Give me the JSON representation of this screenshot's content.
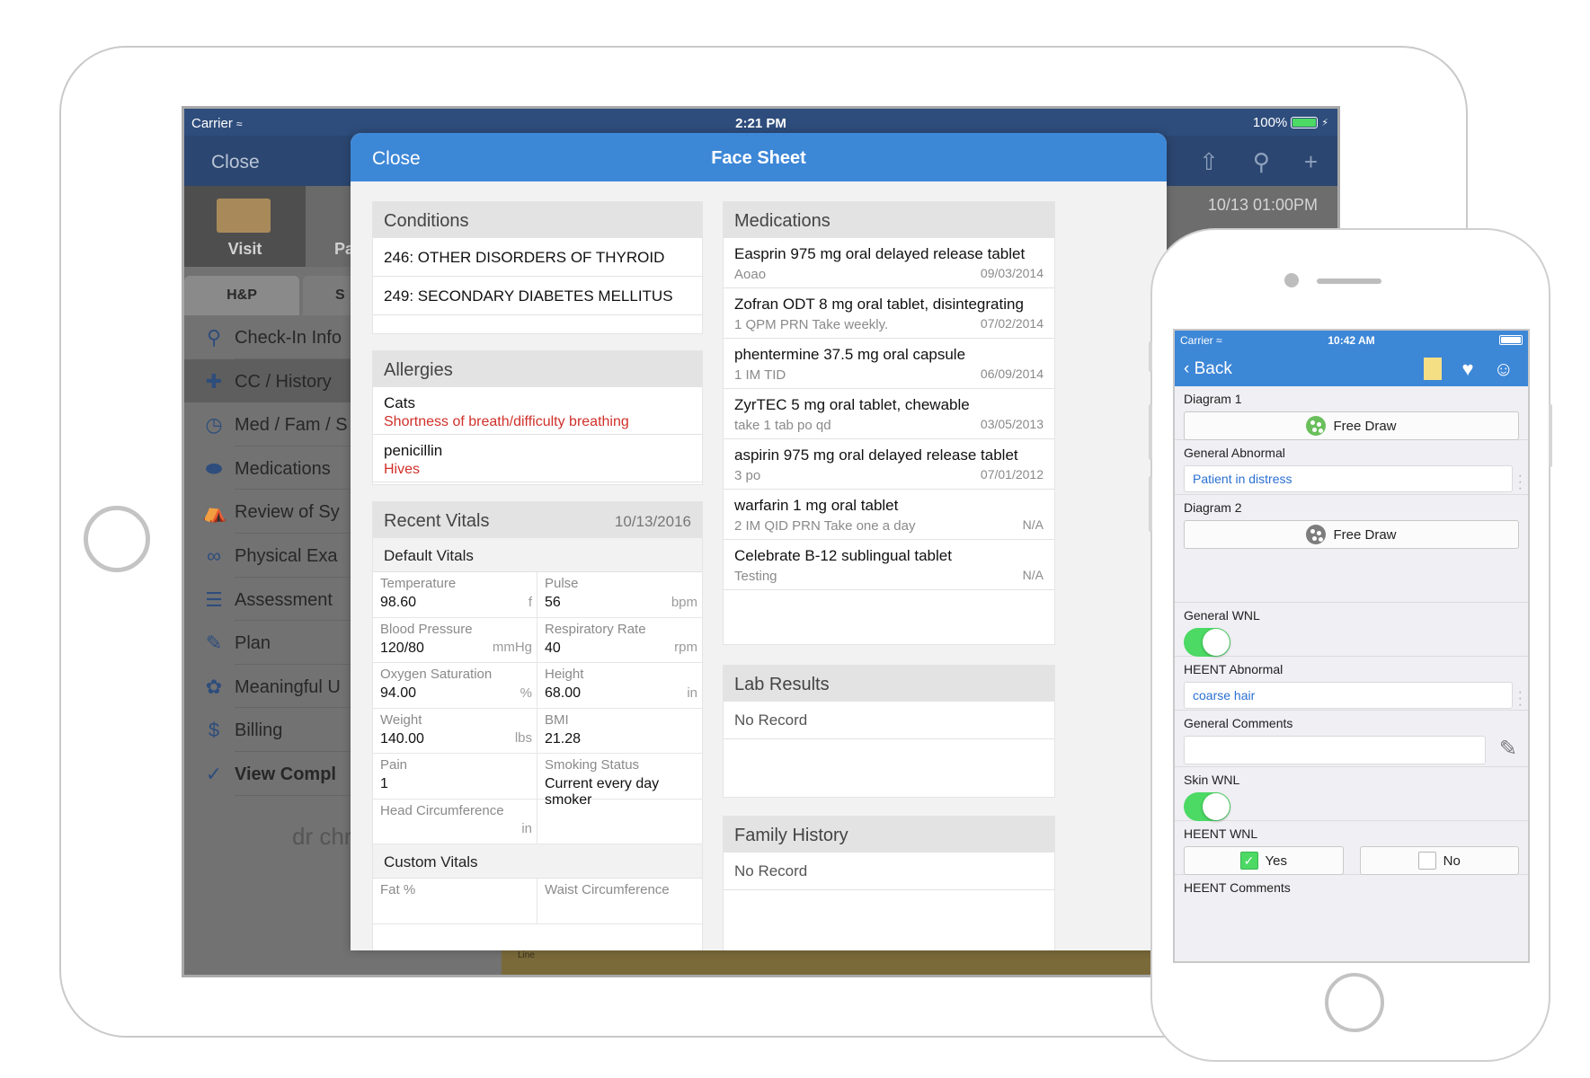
{
  "ipad": {
    "status": {
      "carrier": "Carrier",
      "time": "2:21 PM",
      "battery": "100%"
    },
    "background": {
      "close": "Close",
      "date": "10/13 01:00PM",
      "visit": "Visit",
      "pa_tab": "Pa",
      "tabs": [
        "H&P",
        "S"
      ],
      "menu": [
        {
          "label": "Check-In Info",
          "icon": "map-pin-icon"
        },
        {
          "label": "CC / History",
          "icon": "plus-cross-icon"
        },
        {
          "label": "Med / Fam / S",
          "icon": "history-clock-icon"
        },
        {
          "label": "Medications",
          "icon": "pill-icon"
        },
        {
          "label": "Review of Sy",
          "icon": "body-icon"
        },
        {
          "label": "Physical Exa",
          "icon": "stethoscope-icon"
        },
        {
          "label": "Assessment",
          "icon": "clipboard-icon"
        },
        {
          "label": "Plan",
          "icon": "pen-icon"
        },
        {
          "label": "Meaningful U",
          "icon": "mu-badge-icon"
        },
        {
          "label": "Billing",
          "icon": "dollar-icon"
        },
        {
          "label": "View Compl",
          "icon": "check-document-icon"
        }
      ],
      "logo": "dr chrono",
      "bottom_note": "Line"
    },
    "modal": {
      "close": "Close",
      "title": "Face Sheet",
      "conditions": {
        "header": "Conditions",
        "items": [
          "246: OTHER DISORDERS OF THYROID",
          "249: SECONDARY DIABETES MELLITUS"
        ]
      },
      "allergies": {
        "header": "Allergies",
        "items": [
          {
            "name": "Cats",
            "reaction": "Shortness of breath/difficulty breathing"
          },
          {
            "name": "penicillin",
            "reaction": "Hives"
          }
        ]
      },
      "vitals": {
        "header": "Recent Vitals",
        "date": "10/13/2016",
        "default_title": "Default Vitals",
        "default": [
          {
            "label": "Temperature",
            "value": "98.60",
            "unit": "f"
          },
          {
            "label": "Pulse",
            "value": "56",
            "unit": "bpm"
          },
          {
            "label": "Blood Pressure",
            "value": "120/80",
            "unit": "mmHg"
          },
          {
            "label": "Respiratory Rate",
            "value": "40",
            "unit": "rpm"
          },
          {
            "label": "Oxygen Saturation",
            "value": "94.00",
            "unit": "%"
          },
          {
            "label": "Height",
            "value": "68.00",
            "unit": "in"
          },
          {
            "label": "Weight",
            "value": "140.00",
            "unit": "lbs"
          },
          {
            "label": "BMI",
            "value": "21.28",
            "unit": ""
          },
          {
            "label": "Pain",
            "value": "1",
            "unit": ""
          },
          {
            "label": "Smoking Status",
            "value": "Current every day smoker",
            "unit": ""
          },
          {
            "label": "Head Circumference",
            "value": "",
            "unit": "in"
          },
          {
            "label": "",
            "value": "",
            "unit": ""
          }
        ],
        "custom_title": "Custom Vitals",
        "custom": [
          {
            "label": "Fat %"
          },
          {
            "label": "Waist Circumference"
          }
        ]
      },
      "medications": {
        "header": "Medications",
        "items": [
          {
            "name": "Easprin 975 mg oral delayed release tablet",
            "sig": "Aoao",
            "date": "09/03/2014"
          },
          {
            "name": "Zofran ODT 8 mg oral tablet, disintegrating",
            "sig": "1  QPM PRN Take weekly.",
            "date": "07/02/2014"
          },
          {
            "name": "phentermine 37.5 mg oral capsule",
            "sig": "1  IM TID",
            "date": "06/09/2014"
          },
          {
            "name": "ZyrTEC 5 mg oral tablet, chewable",
            "sig": "take 1 tab po qd",
            "date": "03/05/2013"
          },
          {
            "name": "aspirin 975 mg oral delayed release tablet",
            "sig": "3 po",
            "date": "07/01/2012"
          },
          {
            "name": "warfarin 1 mg oral tablet",
            "sig": "2  IM QID PRN Take one a day",
            "date": "N/A"
          },
          {
            "name": "Celebrate B-12 sublingual tablet",
            "sig": "Testing",
            "date": "N/A"
          }
        ]
      },
      "lab_results": {
        "header": "Lab Results",
        "empty": "No Record"
      },
      "family_history": {
        "header": "Family History",
        "empty": "No Record"
      }
    }
  },
  "iphone": {
    "status": {
      "carrier": "Carrier",
      "time": "10:42 AM"
    },
    "nav": {
      "back": "Back"
    },
    "fields": {
      "diagram1": {
        "label": "Diagram 1",
        "button": "Free Draw"
      },
      "general_abnormal": {
        "label": "General Abnormal",
        "value": "Patient in distress"
      },
      "diagram2": {
        "label": "Diagram 2",
        "button": "Free Draw"
      },
      "general_wnl": {
        "label": "General WNL",
        "on": true
      },
      "heent_abnormal": {
        "label": "HEENT Abnormal",
        "value": "coarse hair"
      },
      "general_comments": {
        "label": "General Comments",
        "value": ""
      },
      "skin_wnl": {
        "label": "Skin WNL",
        "on": true
      },
      "heent_wnl": {
        "label": "HEENT WNL",
        "yes": "Yes",
        "no": "No",
        "selected": "Yes"
      },
      "heent_comments": {
        "label": "HEENT Comments"
      }
    }
  },
  "colors": {
    "accent": "#3d87d7",
    "nav_dark": "#2e4d7c",
    "allergy_red": "#d0302a",
    "toggle_green": "#4cd964"
  }
}
